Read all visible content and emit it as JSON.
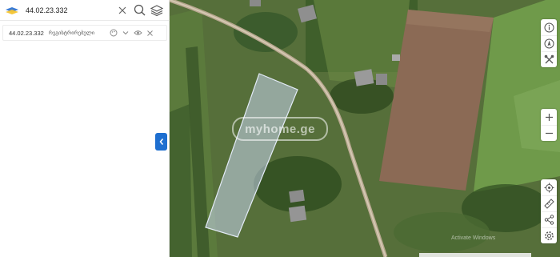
{
  "search": {
    "value": "44.02.23.332",
    "placeholder": ""
  },
  "result": {
    "code": "44.02.23.332",
    "type": "რეგისტრირებული"
  },
  "map": {
    "watermark": "myhome.ge",
    "activate_notice": "Activate Windows"
  },
  "colors": {
    "accent": "#1e6fd0",
    "parcel": "#c8d6ee",
    "logo_blue": "#3a7bd5",
    "logo_yellow": "#f4c430"
  },
  "icons": {
    "logo": "cadastre-logo-icon",
    "clear": "close-icon",
    "search": "search-icon",
    "layers": "layers-icon",
    "palette": "palette-icon",
    "expand": "chevron-down-icon",
    "visibility": "eye-icon",
    "remove": "close-icon",
    "collapse": "chevron-left-icon",
    "info": "info-icon",
    "compass": "compass-icon",
    "tools": "tools-icon",
    "zoom_in": "plus-icon",
    "zoom_out": "minus-icon",
    "locate": "locate-icon",
    "measure": "ruler-icon",
    "share": "share-icon",
    "settings": "gear-icon"
  }
}
